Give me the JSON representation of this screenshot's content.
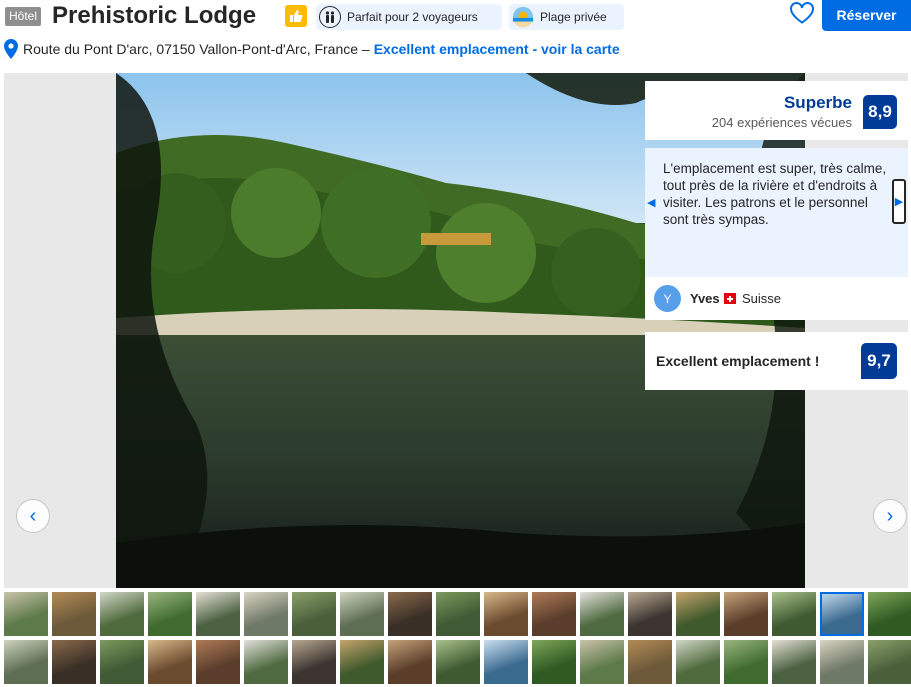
{
  "header": {
    "badge": "Hôtel",
    "title": "Prehistoric Lodge",
    "feature_couple": "Parfait pour 2 voyageurs",
    "feature_beach": "Plage privée",
    "reserve_label": "Réserver"
  },
  "address": {
    "text": "Route du Pont D'arc, 07150 Vallon-Pont-d'Arc, France –",
    "link": "Excellent emplacement - voir la carte"
  },
  "rating": {
    "word": "Superbe",
    "count": "204 expériences vécues",
    "score": "8,9"
  },
  "review": {
    "text": "L'emplacement est super, très calme, tout près de la rivière et d'endroits à visiter. Les patrons et le personnel sont très sympas.",
    "avatar_letter": "Y",
    "author": "Yves",
    "country": "Suisse"
  },
  "location": {
    "label": "Excellent emplacement !",
    "score": "9,7"
  },
  "gallery": {
    "prev_arrow": "‹",
    "next_arrow": "›"
  },
  "colors": {
    "brand_blue": "#006ce4",
    "dark_blue": "#003b95",
    "review_bg": "#ebf3ff",
    "thumbs_badge": "#febb02"
  },
  "icons": [
    "thumbs-up-icon",
    "couple-icon",
    "beach-icon",
    "heart-icon",
    "map-pin-icon",
    "swiss-flag-icon"
  ]
}
